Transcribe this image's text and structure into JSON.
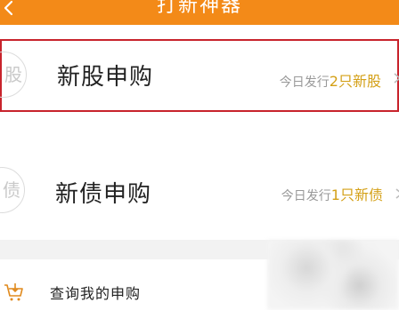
{
  "header": {
    "title": "打新神器",
    "back_icon": "chevron-left-icon",
    "background_color": "#f38a18"
  },
  "rows": [
    {
      "icon_char": "股",
      "title": "新股申购",
      "info_prefix": "今日发行",
      "info_count": "2只",
      "info_suffix": "新股",
      "selected": true
    },
    {
      "icon_char": "债",
      "title": "新债申购",
      "info_prefix": "今日发行",
      "info_count": "1只",
      "info_suffix": "新债",
      "selected": false
    }
  ],
  "query": {
    "icon": "shopping-cart-download-icon",
    "label": "查询我的申购"
  },
  "colors": {
    "accent": "#f38a18",
    "highlight": "#d4a017",
    "selected_border": "#c8232c",
    "separator": "#f2f2f2"
  }
}
